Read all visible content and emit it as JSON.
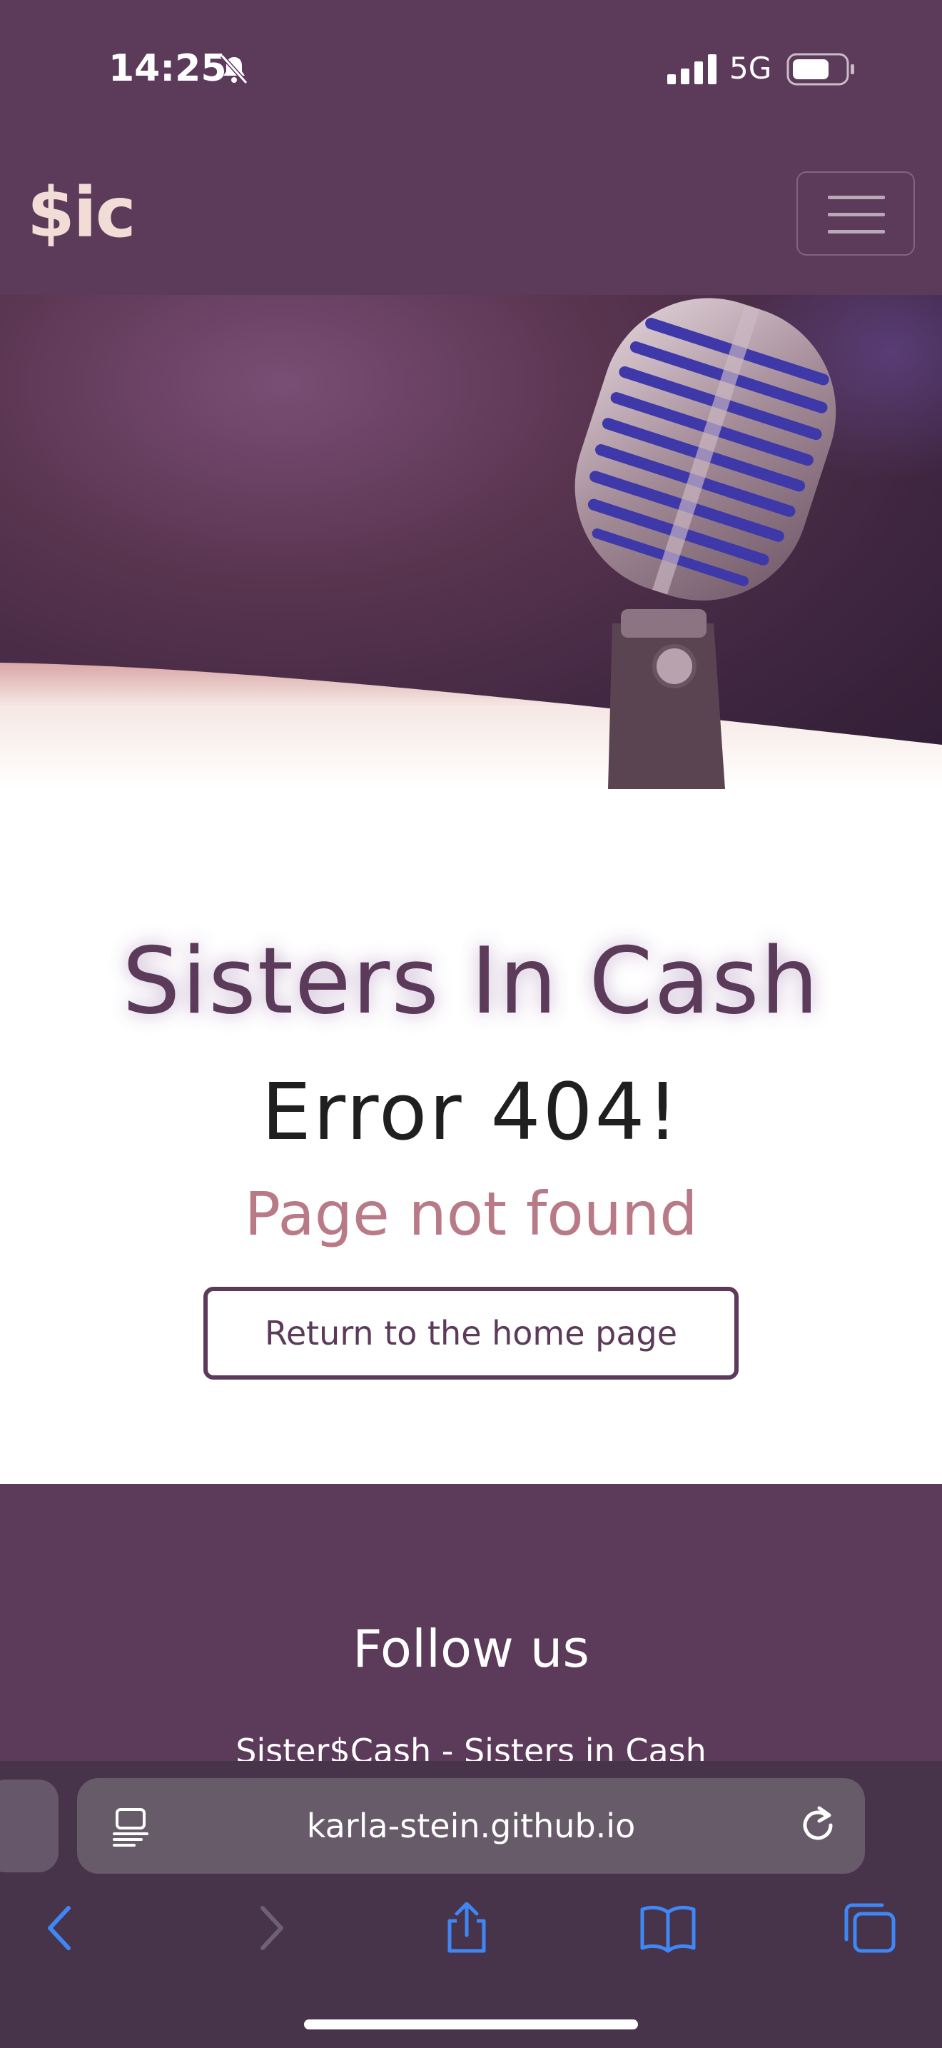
{
  "status_bar": {
    "time": "14:25",
    "network": "5G"
  },
  "navbar": {
    "brand": "$ic"
  },
  "main": {
    "site_title": "Sisters In Cash",
    "error_title": "Error 404!",
    "error_subtitle": "Page not found",
    "home_button_label": "Return to the home page"
  },
  "footer": {
    "heading": "Follow us",
    "text": "Sister$Cash - Sisters in Cash"
  },
  "browser": {
    "url": "karla-stein.github.io"
  },
  "colors": {
    "brand": "#5c3a5a",
    "accent_pink": "#b87a86",
    "safari_ui_blue": "#3f87f5"
  }
}
